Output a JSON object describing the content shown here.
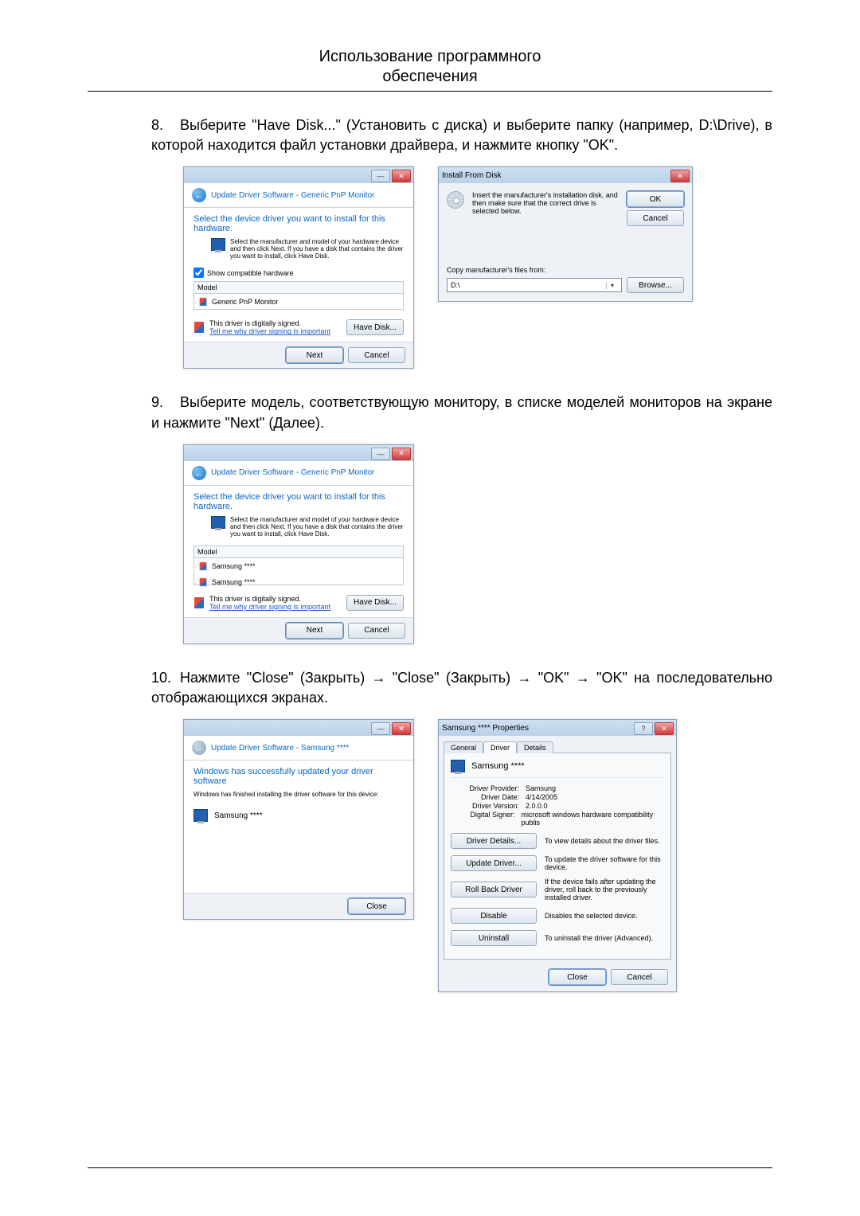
{
  "header": {
    "line1": "Использование программного",
    "line2": "обеспечения"
  },
  "steps": {
    "s8": {
      "num": "8.",
      "text": "Выберите \"Have Disk...\" (Установить с диска) и выберите папку (например, D:\\Drive), в которой находится файл установки драйвера, и нажмите кнопку \"OK\"."
    },
    "s9": {
      "num": "9.",
      "text": "Выберите модель, соответствующую монитору, в списке моделей мониторов на экране и нажмите \"Next\" (Далее)."
    },
    "s10": {
      "num": "10.",
      "text": "Нажмите \"Close\" (Закрыть) → \"Close\" (Закрыть) → \"OK\" → \"OK\" на последовательно отображающихся экранах."
    }
  },
  "wizard8a": {
    "nav_title": "Update Driver Software - Generic PnP Monitor",
    "instr": "Select the device driver you want to install for this hardware.",
    "sub": "Select the manufacturer and model of your hardware device and then click Next. If you have a disk that contains the driver you want to install, click Have Disk.",
    "show_compat": "Show compatible hardware",
    "model_label": "Model",
    "model_item": "Generic PnP Monitor",
    "signed": "This driver is digitally signed.",
    "signed_link": "Tell me why driver signing is important",
    "have_disk": "Have Disk...",
    "next": "Next",
    "cancel": "Cancel"
  },
  "install_from_disk": {
    "title": "Install From Disk",
    "msg": "Insert the manufacturer's installation disk, and then make sure that the correct drive is selected below.",
    "ok": "OK",
    "cancel": "Cancel",
    "copy_label": "Copy manufacturer's files from:",
    "path": "D:\\",
    "browse": "Browse..."
  },
  "wizard9": {
    "nav_title": "Update Driver Software - Generic PnP Monitor",
    "instr": "Select the device driver you want to install for this hardware.",
    "sub": "Select the manufacturer and model of your hardware device and then click Next. If you have a disk that contains the driver you want to install, click Have Disk.",
    "model_label": "Model",
    "model_item1": "Samsung ****",
    "model_item2": "Samsung ****",
    "signed": "This driver is digitally signed.",
    "signed_link": "Tell me why driver signing is important",
    "have_disk": "Have Disk...",
    "next": "Next",
    "cancel": "Cancel"
  },
  "wizard10a": {
    "nav_title": "Update Driver Software - Samsung ****",
    "instr": "Windows has successfully updated your driver software",
    "sub": "Windows has finished installing the driver software for this device:",
    "device": "Samsung ****",
    "close": "Close"
  },
  "properties": {
    "title": "Samsung **** Properties",
    "tabs": {
      "general": "General",
      "driver": "Driver",
      "details": "Details"
    },
    "device": "Samsung ****",
    "kv": {
      "provider_k": "Driver Provider:",
      "provider_v": "Samsung",
      "date_k": "Driver Date:",
      "date_v": "4/14/2005",
      "version_k": "Driver Version:",
      "version_v": "2.0.0.0",
      "signer_k": "Digital Signer:",
      "signer_v": "microsoft windows hardware compatibility publis"
    },
    "actions": {
      "details_btn": "Driver Details...",
      "details_txt": "To view details about the driver files.",
      "update_btn": "Update Driver...",
      "update_txt": "To update the driver software for this device.",
      "rollback_btn": "Roll Back Driver",
      "rollback_txt": "If the device fails after updating the driver, roll back to the previously installed driver.",
      "disable_btn": "Disable",
      "disable_txt": "Disables the selected device.",
      "uninstall_btn": "Uninstall",
      "uninstall_txt": "To uninstall the driver (Advanced)."
    },
    "close": "Close",
    "cancel": "Cancel"
  }
}
